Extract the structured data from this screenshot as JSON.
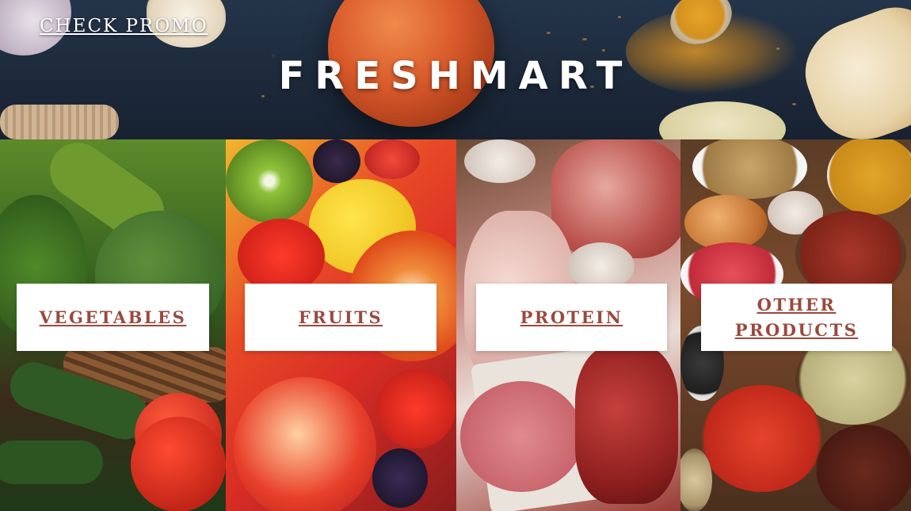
{
  "header": {
    "promo_label": "CHECK PROMO",
    "brand": "FRESHMART"
  },
  "categories": [
    {
      "key": "vegetables",
      "label": "VEGETABLES"
    },
    {
      "key": "fruits",
      "label": "FRUITS"
    },
    {
      "key": "protein",
      "label": "PROTEIN"
    },
    {
      "key": "other",
      "label_line1": "OTHER",
      "label_line2": "PRODUCTS"
    }
  ],
  "colors": {
    "label_text": "#9a4a3e",
    "label_box": "#ffffff",
    "header_bg": "#1d2a3b"
  }
}
